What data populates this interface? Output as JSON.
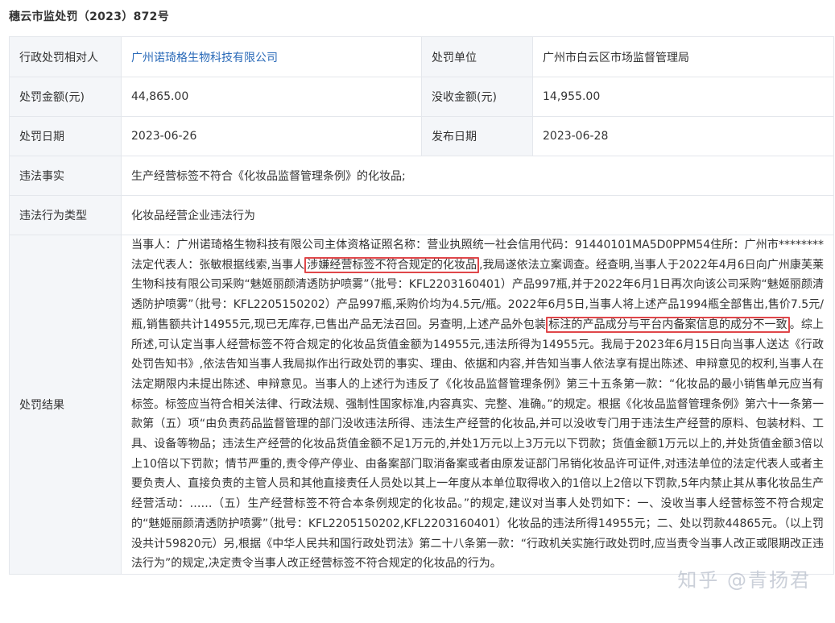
{
  "doc_title": "穗云市监处罚（2023）872号",
  "fields": {
    "party_label": "行政处罚相对人",
    "party_value": "广州诺琦格生物科技有限公司",
    "unit_label": "处罚单位",
    "unit_value": "广州市白云区市场监督管理局",
    "fine_label": "处罚金额(元)",
    "fine_value": "44,865.00",
    "confiscate_label": "没收金额(元)",
    "confiscate_value": "14,955.00",
    "date_label": "处罚日期",
    "date_value": "2023-06-26",
    "publish_label": "发布日期",
    "publish_value": "2023-06-28",
    "fact_label": "违法事实",
    "fact_value": "生产经营标签不符合《化妆品监督管理条例》的化妆品;",
    "type_label": "违法行为类型",
    "type_value": "化妆品经营企业违法行为",
    "result_label": "处罚结果"
  },
  "result": {
    "p1": "当事人：广州诺琦格生物科技有限公司主体资格证照名称：营业执照统一社会信用代码：91440101MA5D0PPM54住所：广州市********法定代表人：张敏根据线索,当事人",
    "hl1": "涉嫌经营标签不符合规定的化妆品",
    "p2": ",我局遂依法立案调查。经查明,当事人于2022年4月6日向广州康芙莱生物科技有限公司采购“魅姬丽颜清透防护喷雾”（批号：KFL2203160401）产品997瓶,并于2022年6月1日再次向该公司采购“魅姬丽颜清透防护喷雾”（批号：KFL2205150202）产品997瓶,采购价均为4.5元/瓶。2022年6月5日,当事人将上述产品1994瓶全部售出,售价7.5元/瓶,销售额共计14955元,现已无库存,已售出产品无法召回。另查明,上述产品外包装",
    "hl2": "标注的产品成分与平台内备案信息的成分不一致",
    "p3": "。综上所述,可认定当事人经营标签不符合规定的化妆品货值金额为14955元,违法所得为14955元。我局于2023年6月15日向当事人送达《行政处罚告知书》,依法告知当事人我局拟作出行政处罚的事实、理由、依据和内容,并告知当事人依法享有提出陈述、申辩意见的权利,当事人在法定期限内未提出陈述、申辩意见。当事人的上述行为违反了《化妆品监督管理条例》第三十五条第一款：“化妆品的最小销售单元应当有标签。标签应当符合相关法律、行政法规、强制性国家标准,内容真实、完整、准确。”的规定。根据《化妆品监督管理条例》第六十一条第一款第（五）项“由负责药品监督管理的部门没收违法所得、违法生产经营的化妆品,并可以没收专门用于违法生产经营的原料、包装材料、工具、设备等物品；违法生产经营的化妆品货值金额不足1万元的,并处1万元以上3万元以下罚款；货值金额1万元以上的,并处货值金额3倍以上10倍以下罚款；情节严重的,责令停产停业、由备案部门取消备案或者由原发证部门吊销化妆品许可证件,对违法单位的法定代表人或者主要负责人、直接负责的主管人员和其他直接责任人员处以其上一年度从本单位取得收入的1倍以上2倍以下罚款,5年内禁止其从事化妆品生产经营活动：……（五）生产经营标签不符合本条例规定的化妆品。”的规定,建议对当事人处罚如下：一、没收当事人经营标签不符合规定的“魅姬丽颜清透防护喷雾”（批号：KFL2205150202,KFL2203160401）化妆品的违法所得14955元；二、处以罚款44865元。（以上罚没共计59820元）另,根据《中华人民共和国行政处罚法》第二十八条第一款：“行政机关实施行政处罚时,应当责令当事人改正或限期改正违法行为”的规定,决定责令当事人改正经营标签不符合规定的化妆品的行为。"
  },
  "watermark": "知乎 @青扬君"
}
